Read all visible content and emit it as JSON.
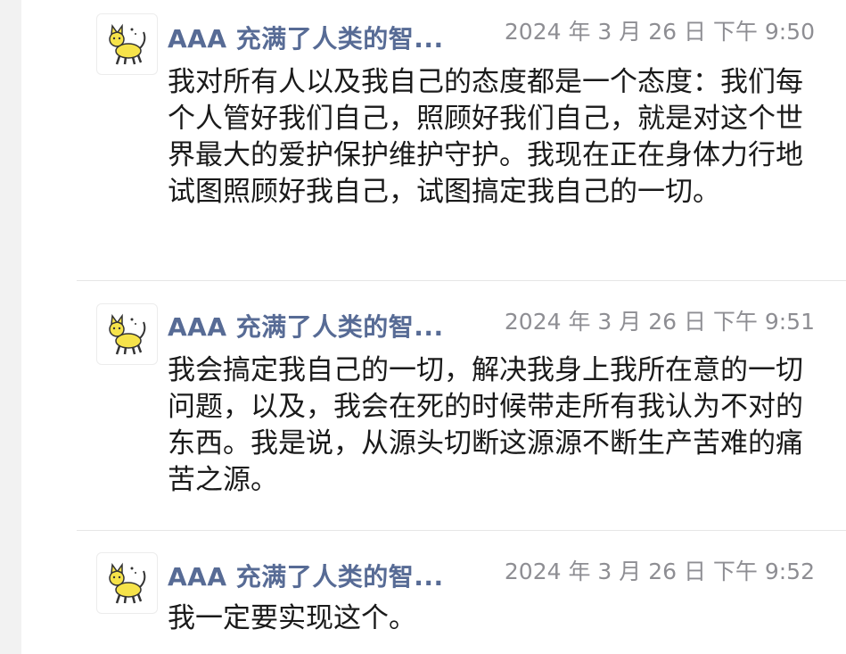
{
  "messages": [
    {
      "sender": "AAA 充满了人类的智...",
      "time": "2024 年 3 月 26 日 下午 9:50",
      "text": "我对所有人以及我自己的态度都是一个态度：我们每个人管好我们自己，照顾好我们自己，就是对这个世界最大的爱护保护维护守护。我现在正在身体力行地试图照顾好我自己，试图搞定我自己的一切。",
      "avatar_icon": "yellow-cat-icon"
    },
    {
      "sender": "AAA 充满了人类的智...",
      "time": "2024 年 3 月 26 日 下午 9:51",
      "text": "我会搞定我自己的一切，解决我身上我所在意的一切问题，以及，我会在死的时候带走所有我认为不对的东西。我是说，从源头切断这源源不断生产苦难的痛苦之源。",
      "avatar_icon": "yellow-cat-icon"
    },
    {
      "sender": "AAA 充满了人类的智...",
      "time": "2024 年 3 月 26 日 下午 9:52",
      "text": "我一定要实现这个。",
      "avatar_icon": "yellow-cat-icon"
    }
  ],
  "colors": {
    "sender": "#576b95",
    "time": "#8e8e93",
    "text": "#1a1a1a",
    "avatar_cat": "#f6e34a"
  }
}
